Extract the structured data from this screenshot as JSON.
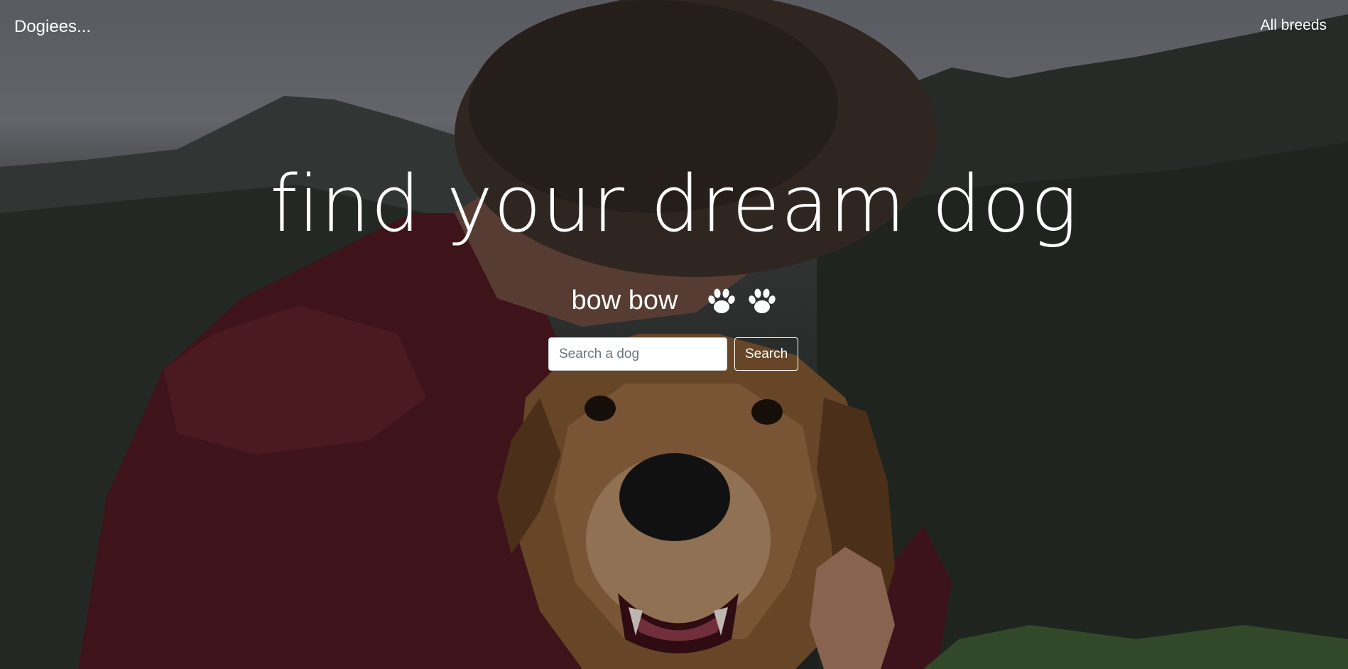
{
  "navbar": {
    "brand": "Dogiees...",
    "link": "All breeds"
  },
  "hero": {
    "headline": "find your dream dog",
    "subline": "bow bow",
    "paw_icons": [
      "paw-icon",
      "paw-icon"
    ],
    "background": "photo of man hugging golden retriever"
  },
  "search": {
    "placeholder": "Search a dog",
    "value": "",
    "button_label": "Search"
  },
  "colors": {
    "text": "#ffffff",
    "shirt": "#5a1a24",
    "dog_fur": "#9a6a3e"
  }
}
